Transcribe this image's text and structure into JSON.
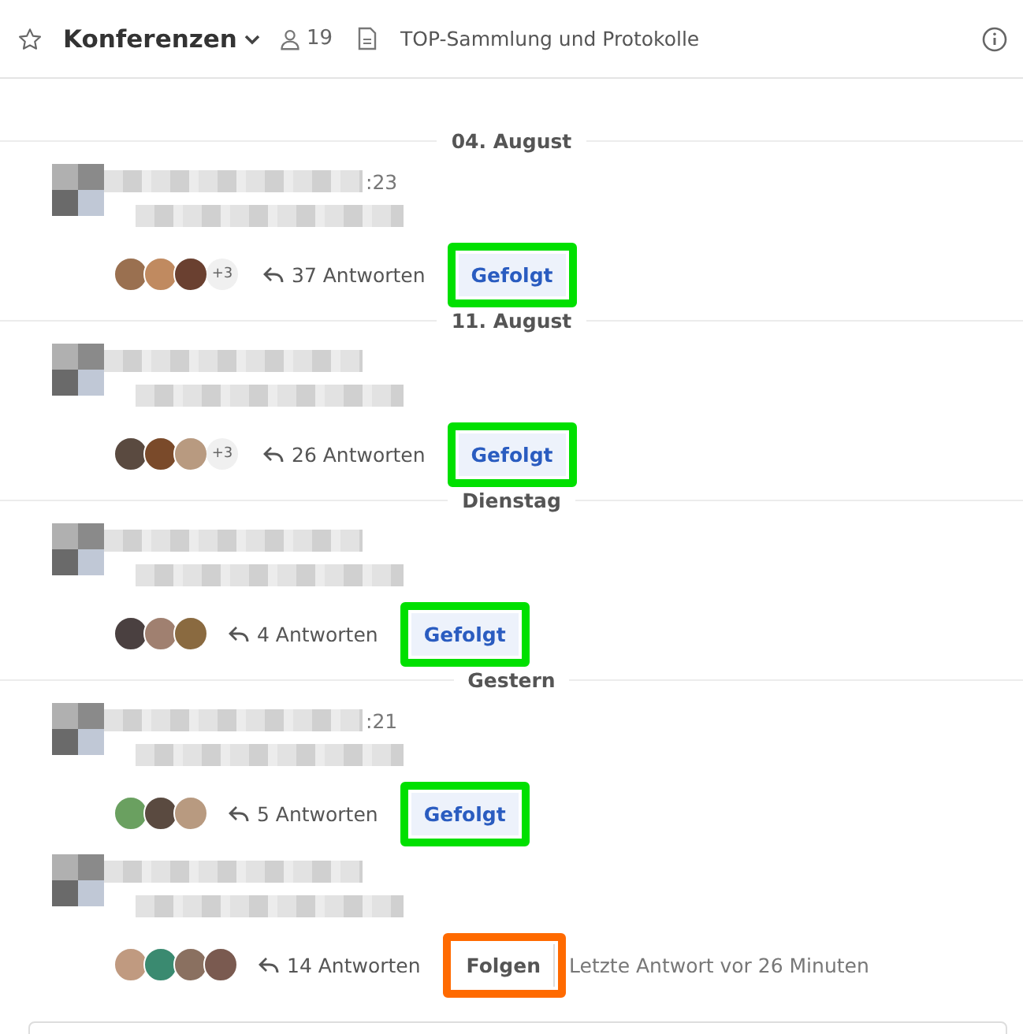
{
  "header": {
    "title": "Konferenzen",
    "members": "19",
    "topic": "TOP-Sammlung und Protokolle"
  },
  "threads": [
    {
      "date": "04. August",
      "time": ":23",
      "avatars": [
        {
          "color": "#9a7050"
        },
        {
          "color": "#c08a60"
        },
        {
          "color": "#6a4030"
        }
      ],
      "more": "+3",
      "replies": "37 Antworten",
      "follow": {
        "label": "Gefolgt",
        "following": true
      },
      "highlight": {
        "color": "#00e000"
      }
    },
    {
      "date": "11. August",
      "avatars": [
        {
          "color": "#5a4a40"
        },
        {
          "color": "#7a4a2a"
        },
        {
          "color": "#b89a80"
        }
      ],
      "more": "+3",
      "replies": "26 Antworten",
      "follow": {
        "label": "Gefolgt",
        "following": true
      },
      "highlight": {
        "color": "#00e000"
      }
    },
    {
      "date": "Dienstag",
      "avatars": [
        {
          "color": "#4a4040"
        },
        {
          "color": "#a08070"
        },
        {
          "color": "#8a6a40"
        }
      ],
      "replies": "4 Antworten",
      "follow": {
        "label": "Gefolgt",
        "following": true
      },
      "highlight": {
        "color": "#00e000"
      }
    },
    {
      "date": "Gestern",
      "time": ":21",
      "avatars": [
        {
          "color": "#6aa060"
        },
        {
          "color": "#5a4a40"
        },
        {
          "color": "#b89a80"
        }
      ],
      "replies": "5 Antworten",
      "follow": {
        "label": "Gefolgt",
        "following": true
      },
      "highlight": {
        "color": "#00e000"
      }
    },
    {
      "avatars": [
        {
          "color": "#c09a80"
        },
        {
          "color": "#3a8a70"
        },
        {
          "color": "#8a7060"
        },
        {
          "color": "#7a5a50"
        }
      ],
      "replies": "14 Antworten",
      "follow": {
        "label": "Folgen",
        "following": false
      },
      "highlight": {
        "color": "#ff6a00"
      },
      "last": "Letzte Antwort vor 26 Minuten"
    }
  ]
}
